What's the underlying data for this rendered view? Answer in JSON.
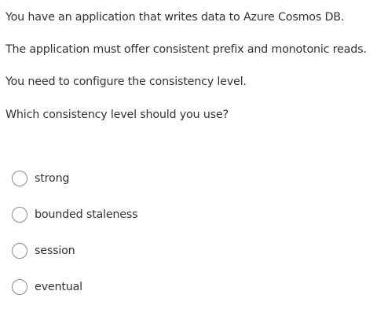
{
  "question": {
    "lines": [
      "You have an application that writes data to Azure Cosmos DB.",
      "The application must offer consistent prefix and monotonic reads.",
      "You need to configure the consistency level.",
      "Which consistency level should you use?"
    ]
  },
  "options": [
    {
      "label": "strong",
      "selected": false
    },
    {
      "label": "bounded staleness",
      "selected": false
    },
    {
      "label": "session",
      "selected": false
    },
    {
      "label": "eventual",
      "selected": false
    }
  ]
}
